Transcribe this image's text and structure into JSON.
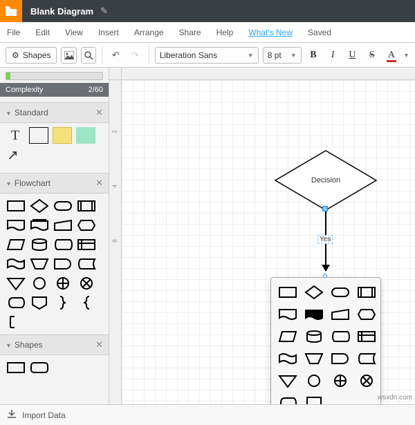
{
  "titlebar": {
    "title": "Blank Diagram"
  },
  "menu": {
    "file": "File",
    "edit": "Edit",
    "view": "View",
    "insert": "Insert",
    "arrange": "Arrange",
    "share": "Share",
    "help": "Help",
    "whatsnew": "What's New",
    "saved": "Saved"
  },
  "toolbar": {
    "shapes": "Shapes",
    "font": "Liberation Sans",
    "size": "8 pt",
    "bold": "B",
    "italic": "I",
    "underline": "U",
    "strike": "S",
    "fontcolor": "A"
  },
  "complexity": {
    "label": "Complexity",
    "value": "2/60"
  },
  "panels": {
    "standard": "Standard",
    "flowchart": "Flowchart",
    "shapes": "Shapes",
    "text_glyph": "T"
  },
  "canvas": {
    "decision_label": "Decision",
    "edge_label": "Yes",
    "ruler_marks": [
      "2",
      "4",
      "6"
    ]
  },
  "footer": {
    "import": "Import Data"
  },
  "watermark": "wsxdn.com"
}
